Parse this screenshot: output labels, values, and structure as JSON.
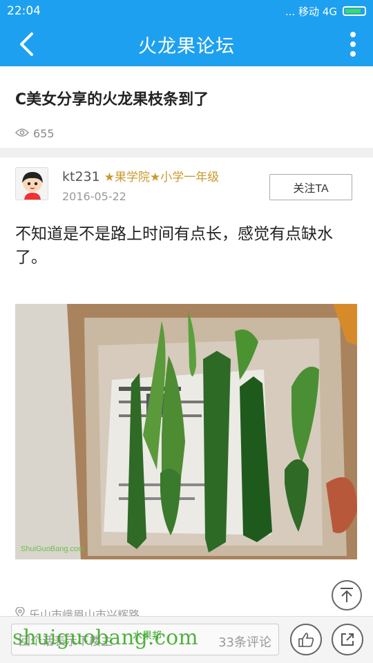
{
  "status_bar": {
    "time": "22:04",
    "network": "... 移动 4G"
  },
  "app_bar": {
    "title": "火龙果论坛",
    "back_icon": "chevron-left",
    "more_icon": "vertical-ellipsis"
  },
  "post": {
    "title": "C美女分享的火龙果枝条到了",
    "views": "655",
    "author": {
      "name": "kt231",
      "rank": "★果学院★小学一年级",
      "date": "2016-05-22",
      "follow_label": "关注TA"
    },
    "body": "不知道是不是路上时间有点长，感觉有点缺水了。",
    "image_watermark": "ShuiGuoBang.com",
    "location": "乐山市峨眉山市兴辉路"
  },
  "bottom_bar": {
    "comment_placeholder": "回个话表示下楼主",
    "comment_count": "33条评论"
  },
  "watermark": {
    "text": "shuiguobang.com",
    "sub": "水果邦"
  },
  "colors": {
    "accent": "#1ea0f0",
    "rank": "#c79a2e",
    "watermark": "#3faa2a"
  }
}
